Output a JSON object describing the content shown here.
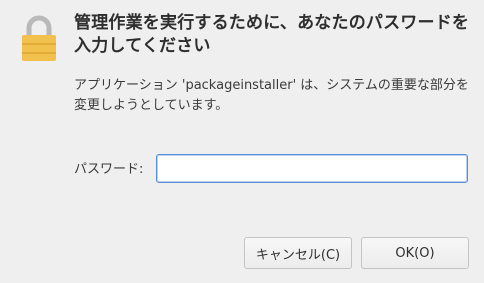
{
  "dialog": {
    "icon": "lock-icon",
    "title": "管理作業を実行するために、あなたのパスワードを入力してください",
    "description": "アプリケーション 'packageinstaller' は、システムの重要な部分を変更しようとしています。",
    "password_label": "パスワード:",
    "password_value": "",
    "password_placeholder": "",
    "cancel_label": "キャンセル(C)",
    "ok_label": "OK(O)"
  },
  "colors": {
    "background": "#efefef",
    "lock_body": "#f2c04d",
    "lock_shackle": "#b9b9b9",
    "input_focus_border": "#5a8ed6"
  }
}
